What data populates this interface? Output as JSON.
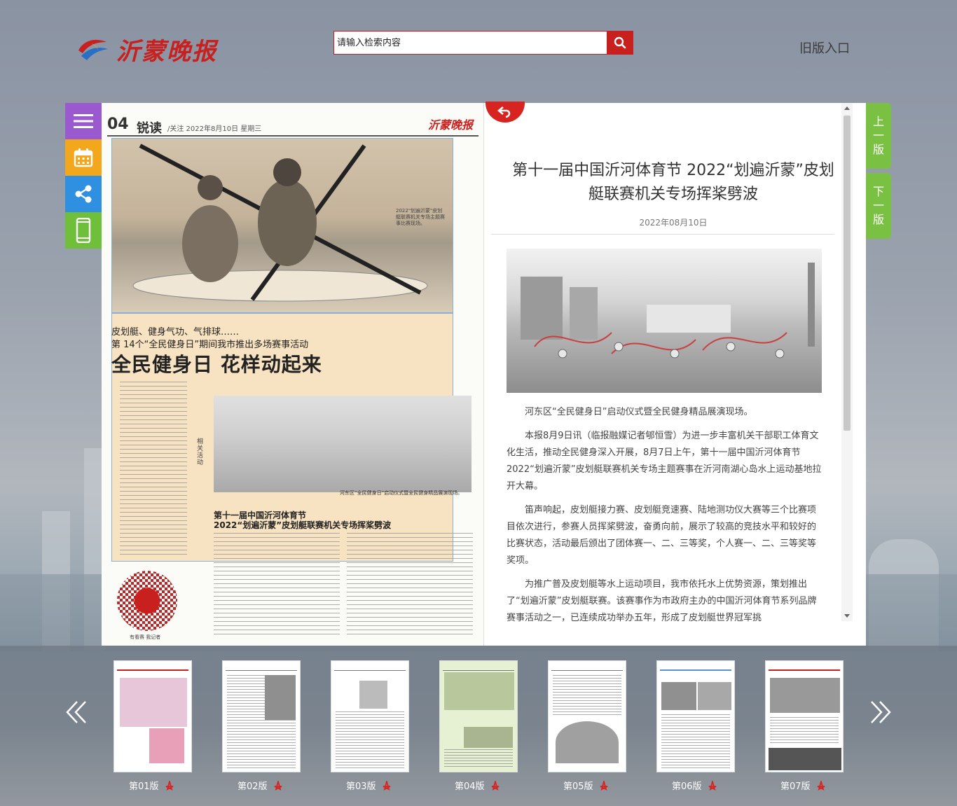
{
  "header": {
    "logo_text": "沂蒙晚报",
    "search_placeholder": "请输入检索内容",
    "old_version": "旧版入口"
  },
  "tools": [
    "menu-icon",
    "calendar-icon",
    "share-icon",
    "mobile-icon"
  ],
  "page_nav": {
    "prev": [
      "上",
      "一",
      "版"
    ],
    "next": [
      "下",
      "一",
      "版"
    ]
  },
  "newspaper": {
    "page_num": "04",
    "section": "锐读",
    "sub": "/关注  2022年8月10日 星期三",
    "brand": "沂蒙晚报",
    "photo1_caption": "2022\"划遍沂蒙\"皮划艇联赛机关专场主题赛事比赛现场。",
    "kicker1": "皮划艇、健身气功、气排球……",
    "kicker2": "第 14个“全民健身日”期间我市推出多场赛事活动",
    "headline": "全民健身日  花样动起来",
    "side_label": "相关活动",
    "photo2_caption": "河东区“全民健身日”启动仪式暨全民健身精品展演现场。",
    "sub2a": "第十一届中国沂河体育节",
    "sub2b": "2022“划遍沂蒙”皮划艇联赛机关专场挥桨劈波",
    "qr_caption": "有看赛  我记者"
  },
  "article": {
    "title": "第十一届中国沂河体育节 2022“划遍沂蒙”皮划艇联赛机关专场挥桨劈波",
    "date": "2022年08月10日",
    "paragraphs": [
      "河东区“全民健身日”启动仪式暨全民健身精品展演现场。",
      "本报8月9日讯（临报融媒记者郇恒雪）为进一步丰富机关干部职工体育文化生活，推动全民健身深入开展，8月7日上午，第十一届中国沂河体育节2022“划遍沂蒙”皮划艇联赛机关专场主题赛事在沂河南湖心岛水上运动基地拉开大幕。",
      "笛声响起，皮划艇接力赛、皮划艇竞速赛、陆地测功仪大赛等三个比赛项目依次进行，参赛人员挥桨劈波，奋勇向前，展示了较高的竞技水平和较好的比赛状态，活动最后颁出了团体赛一、二、三等奖，个人赛一、二、三等奖等奖项。",
      "为推广普及皮划艇等水上运动项目，我市依托水上优势资源，策划推出了“划遍沂蒙”皮划艇联赛。该赛事作为市政府主办的中国沂河体育节系列品牌赛事活动之一，已连续成功举办五年，形成了皮划艇世界冠军挑"
    ]
  },
  "thumbnails": [
    {
      "label": "第01版"
    },
    {
      "label": "第02版"
    },
    {
      "label": "第03版"
    },
    {
      "label": "第04版"
    },
    {
      "label": "第05版"
    },
    {
      "label": "第06版"
    },
    {
      "label": "第07版"
    }
  ],
  "colors": {
    "brand_red": "#c8201e",
    "nav_green": "#7ac143",
    "menu_purple": "#9b59d0",
    "calendar_orange": "#f2a71c",
    "share_blue": "#2f8fe0"
  }
}
